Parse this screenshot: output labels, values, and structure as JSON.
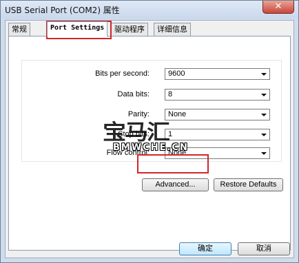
{
  "window": {
    "title": "USB Serial Port (COM2) 属性",
    "close_label": "✕"
  },
  "tabs": [
    {
      "label": "常规",
      "active": false
    },
    {
      "label": "Port Settings",
      "active": true
    },
    {
      "label": "驱动程序",
      "active": false
    },
    {
      "label": "详细信息",
      "active": false
    }
  ],
  "settings": {
    "bits_per_second": {
      "label": "Bits per second:",
      "value": "9600"
    },
    "data_bits": {
      "label": "Data bits:",
      "value": "8"
    },
    "parity": {
      "label": "Parity:",
      "value": "None"
    },
    "stop_bits": {
      "label": "Stop bits:",
      "value": "1"
    },
    "flow_control": {
      "label": "Flow control:",
      "value": "None"
    }
  },
  "buttons": {
    "advanced": "Advanced...",
    "restore_defaults": "Restore Defaults",
    "ok": "确定",
    "cancel": "取消"
  },
  "watermark": {
    "logo": "宝马汇",
    "text": "BMWCHE.CN"
  },
  "colors": {
    "highlight": "#d0262a"
  }
}
